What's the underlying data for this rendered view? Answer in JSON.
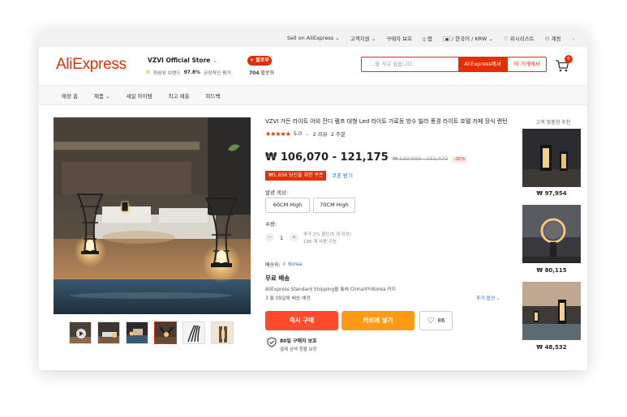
{
  "topbar": {
    "sell": "Sell on AliExpress",
    "support": "고객지원",
    "buyer_protection": "구매자 보호",
    "app": "앱",
    "locale": "/ 한국어 / KRW",
    "wishlist": "위시리스트",
    "account": "계정"
  },
  "header": {
    "logo": "AliExpress",
    "store_name": "VZVI Official Store",
    "badge": "최상위 브랜드",
    "rating_pct": "97.8%",
    "rating_label": "긍정적인 평가",
    "follow": "+ 팔로우",
    "followers_count": "704",
    "followers_label": "팔로워",
    "search_placeholder": "...을 사고 싶습니다.",
    "search_ae": "AliExpress에서",
    "search_store": "이 가게에서",
    "cart_count": "0"
  },
  "nav": {
    "items": [
      "매장 홈",
      "제품",
      "세일 아이템",
      "최고 매출",
      "피드백"
    ]
  },
  "product": {
    "title": "VZVI 가든 라이트 야외 잔디 램프 대형 Led 라이트 가로등 방수 빌라 풍경 라이트 호텔 카페 장식 랜턴",
    "rating": "5.0",
    "reviews": "2 리뷰",
    "orders": "2 주문",
    "price": "₩ 106,070 - 121,175",
    "old_price": "₩ 132,593 - 151,472",
    "discount": "-20%",
    "coupon": "₩1,856 당신을 위한 쿠폰",
    "coupon_link": "쿠폰 받기",
    "color_label": "발광 색상:",
    "options": [
      "60CM High",
      "70CM High"
    ],
    "qty_label": "수량:",
    "qty_value": "1",
    "qty_note1": "추가 2% 할인(5 개 이상)",
    "qty_note2": "196 개 사용 가능",
    "ship_to_label": "배송지:",
    "ship_to": "Korea",
    "free_shipping": "무료 배송",
    "ship_detail": "AliExpress Standard Shipping을 통해 China부터Korea 까지",
    "ship_date": "3 월 09일에 배송 예정",
    "more_options": "추가 옵션",
    "buy_now": "즉시 구매",
    "add_cart": "카트에 넣기",
    "wish_count": "86",
    "guarantee_title": "80일 구매자 보호",
    "guarantee_sub": "결제 금액 환불 보장"
  },
  "recommend": {
    "title": "고객 맞춤형 추천",
    "prices": [
      "₩ 97,954",
      "₩ 80,115",
      "₩ 48,532"
    ]
  },
  "colors": {
    "accent": "#e62e04",
    "buy": "#ff4b2b",
    "cart": "#ff9a16",
    "link": "#1a6fd6"
  }
}
